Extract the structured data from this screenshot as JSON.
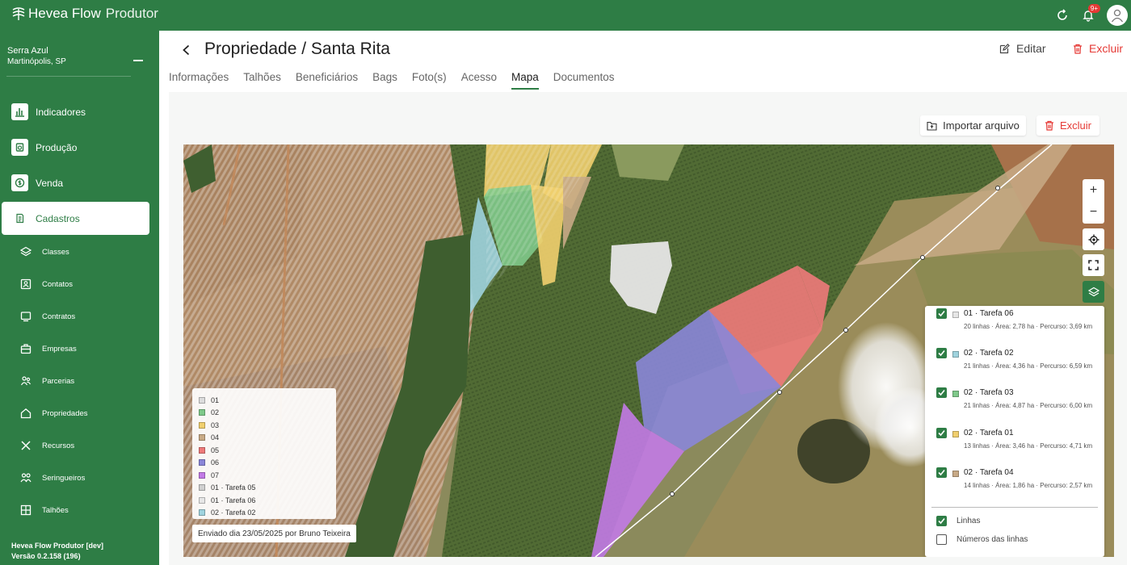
{
  "app": {
    "brand_name": "Hevea Flow",
    "brand_suffix": "Produtor",
    "notifications_badge": "9+"
  },
  "sidebar": {
    "farm_name": "Serra Azul",
    "farm_city": "Martinópolis, SP",
    "main_items": [
      {
        "label": "Indicadores",
        "icon": "chart-icon"
      },
      {
        "label": "Produção",
        "icon": "production-icon"
      },
      {
        "label": "Venda",
        "icon": "money-icon"
      },
      {
        "label": "Cadastros",
        "icon": "document-icon",
        "active": true
      }
    ],
    "sub_items": [
      {
        "label": "Classes",
        "icon": "layers-icon"
      },
      {
        "label": "Contatos",
        "icon": "contact-icon"
      },
      {
        "label": "Contratos",
        "icon": "contract-icon"
      },
      {
        "label": "Empresas",
        "icon": "company-icon"
      },
      {
        "label": "Parcerias",
        "icon": "partnership-icon"
      },
      {
        "label": "Propriedades",
        "icon": "home-icon"
      },
      {
        "label": "Recursos",
        "icon": "tools-icon"
      },
      {
        "label": "Seringueiros",
        "icon": "workers-icon"
      },
      {
        "label": "Talhões",
        "icon": "grid-icon"
      }
    ],
    "version_line1": "Hevea Flow Produtor [dev]",
    "version_line2": "Versão 0.2.158 (196)"
  },
  "header": {
    "title": "Propriedade / Santa Rita",
    "edit_label": "Editar",
    "delete_label": "Excluir"
  },
  "tabs": [
    {
      "label": "Informações"
    },
    {
      "label": "Talhões"
    },
    {
      "label": "Beneficiários"
    },
    {
      "label": "Bags"
    },
    {
      "label": "Foto(s)"
    },
    {
      "label": "Acesso"
    },
    {
      "label": "Mapa",
      "active": true
    },
    {
      "label": "Documentos"
    }
  ],
  "map_toolbar": {
    "import_label": "Importar arquivo",
    "delete_label": "Excluir"
  },
  "map": {
    "controls": {
      "zoom_in": "+",
      "zoom_out": "−"
    },
    "legend": [
      {
        "label": "01",
        "color": "#dcdcdc"
      },
      {
        "label": "02",
        "color": "#7fc98a"
      },
      {
        "label": "03",
        "color": "#f1cf6e"
      },
      {
        "label": "04",
        "color": "#c8aa86"
      },
      {
        "label": "05",
        "color": "#ee7a7a"
      },
      {
        "label": "06",
        "color": "#8a86d8"
      },
      {
        "label": "07",
        "color": "#c27ae6"
      },
      {
        "label": "01 · Tarefa 05",
        "color": "#cfcfcf"
      },
      {
        "label": "01 · Tarefa 06",
        "color": "#e6e6e6"
      },
      {
        "label": "02 · Tarefa 02",
        "color": "#9fd3de"
      }
    ],
    "sent_info": "Enviado dia 23/05/2025 por Bruno Teixeira",
    "tasks": [
      {
        "name": "01 · Tarefa 06",
        "details": "20 linhas · Área: 2,78 ha · Percurso: 3,69 km",
        "color": "#e6e6e6",
        "checked": true
      },
      {
        "name": "02 · Tarefa 02",
        "details": "21 linhas · Área: 4,36 ha · Percurso: 6,59 km",
        "color": "#9fd3de",
        "checked": true
      },
      {
        "name": "02 · Tarefa 03",
        "details": "21 linhas · Área: 4,87 ha · Percurso: 6,00 km",
        "color": "#7fc98a",
        "checked": true
      },
      {
        "name": "02 · Tarefa 01",
        "details": "13 linhas · Área: 3,46 ha · Percurso: 4,71 km",
        "color": "#f1cf6e",
        "checked": true
      },
      {
        "name": "02 · Tarefa 04",
        "details": "14 linhas · Área: 1,86 ha · Percurso: 2,57 km",
        "color": "#c8aa86",
        "checked": true
      }
    ],
    "options": [
      {
        "label": "Linhas",
        "checked": true
      },
      {
        "label": "Números das linhas",
        "checked": false
      }
    ]
  }
}
